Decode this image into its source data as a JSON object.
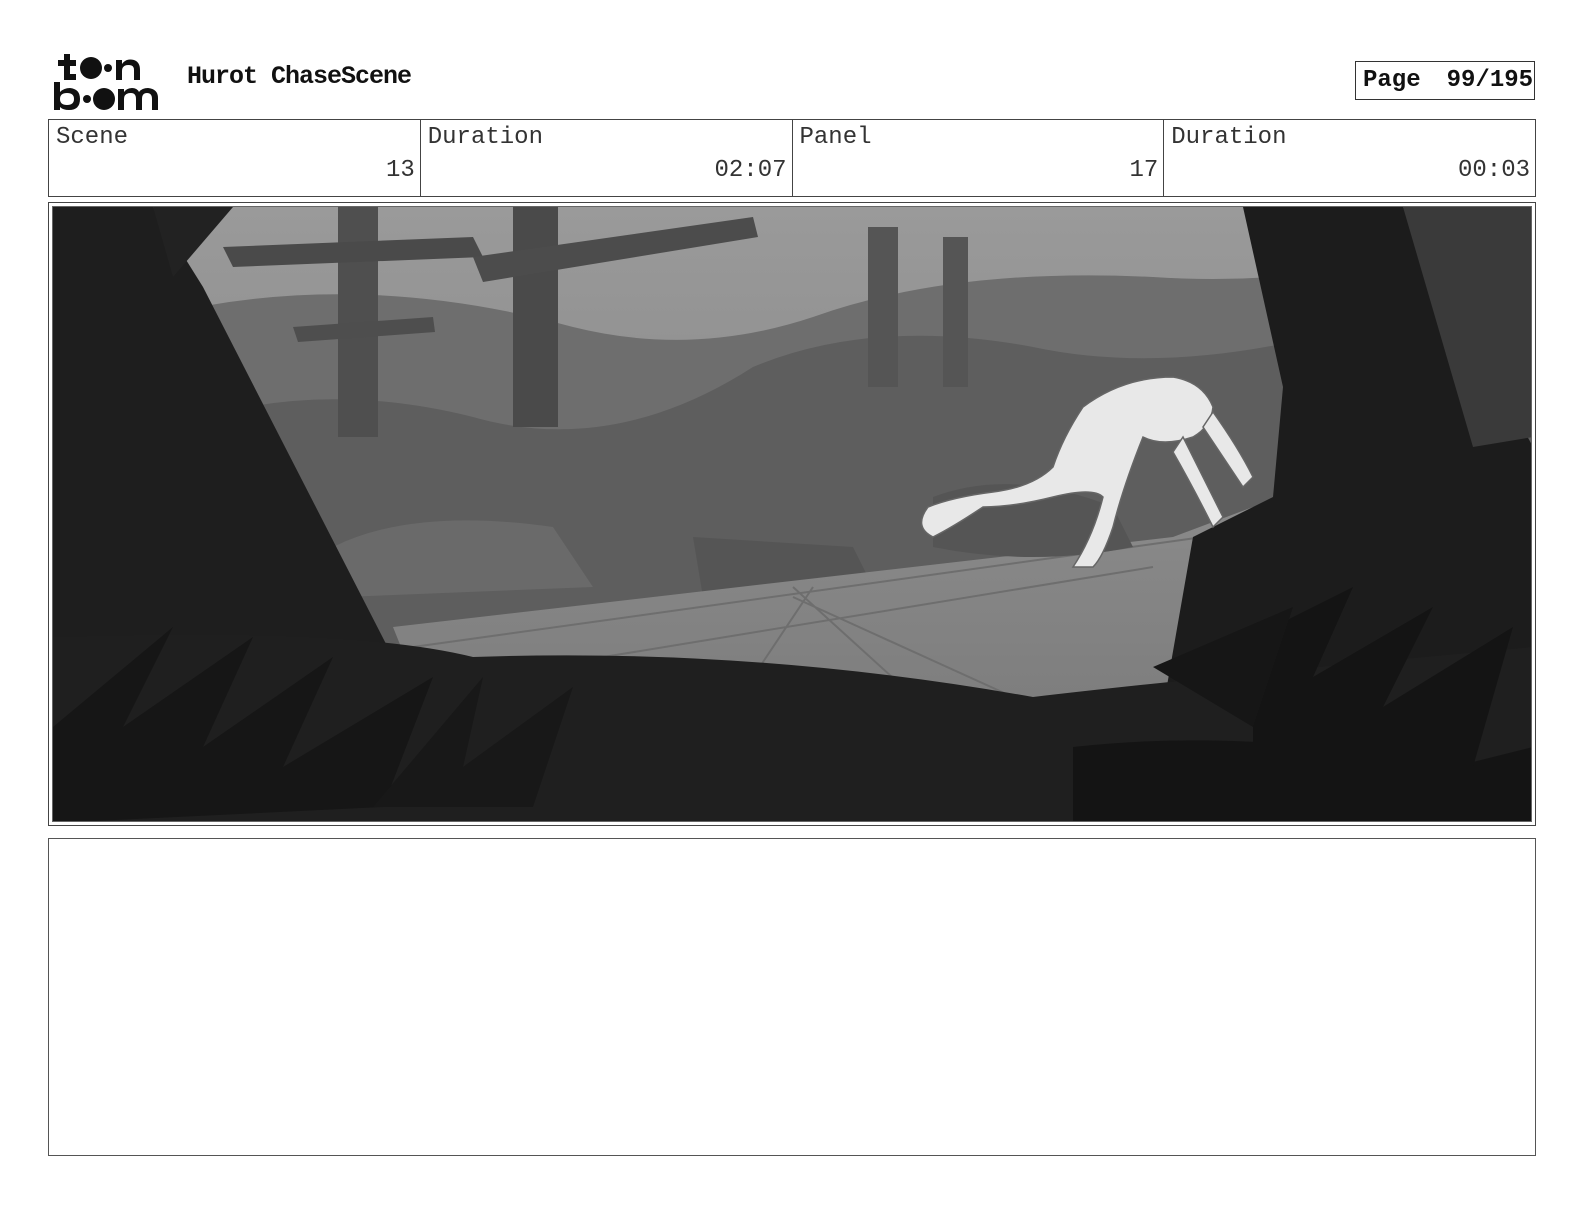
{
  "header": {
    "logo_text": "toon boom",
    "title": "Hurot ChaseScene",
    "page_label": "Page",
    "page_value": "99/195"
  },
  "info": [
    {
      "label": "Scene",
      "value": "13"
    },
    {
      "label": "Duration",
      "value": "02:07"
    },
    {
      "label": "Panel",
      "value": "17"
    },
    {
      "label": "Duration",
      "value": "00:03"
    }
  ],
  "notes": ""
}
